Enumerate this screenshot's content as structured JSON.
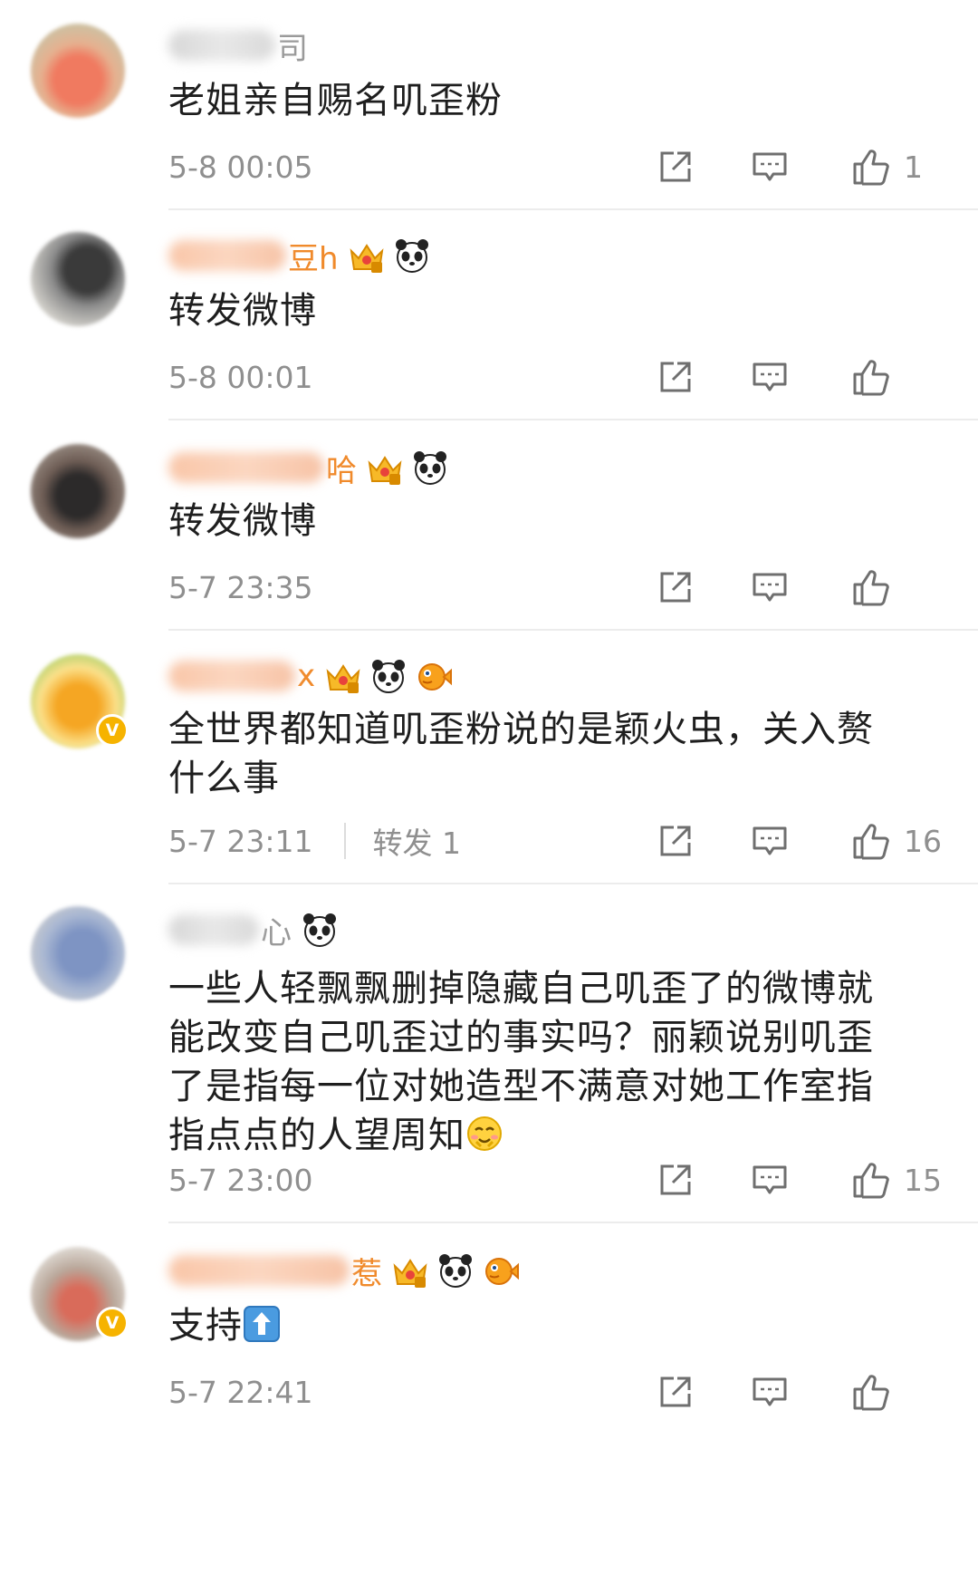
{
  "comments": [
    {
      "name_visible": "司",
      "text": "老姐亲自赐名叽歪粉",
      "time": "5-8 00:05",
      "repost": "",
      "likes": "1",
      "badges": []
    },
    {
      "name_visible": "豆h",
      "text": "转发微博",
      "time": "5-8 00:01",
      "repost": "",
      "likes": "",
      "badges": [
        "crown-badge-icon",
        "panda-badge-icon"
      ]
    },
    {
      "name_visible": "哈",
      "text": "转发微博",
      "time": "5-7 23:35",
      "repost": "",
      "likes": "",
      "badges": [
        "crown-badge-icon",
        "panda-badge-icon"
      ]
    },
    {
      "name_visible": "x",
      "text_line1": "全世界都知道叽歪粉说的是颖火虫，关入赘",
      "text_line2": "什么事",
      "time": "5-7 23:11",
      "repost": "转发 1",
      "likes": "16",
      "badges": [
        "crown-badge-icon",
        "panda-badge-icon",
        "pufferfish-badge-icon"
      ]
    },
    {
      "name_visible": "心",
      "text_line1": "一些人轻飘飘删掉隐藏自己叽歪了的微博就",
      "text_line2": "能改变自己叽歪过的事实吗？丽颖说别叽歪",
      "text_line3": "了是指每一位对她造型不满意对她工作室指",
      "text_line4": "指点点的人望周知",
      "time": "5-7 23:00",
      "repost": "",
      "likes": "15",
      "badges": [
        "panda-badge-icon"
      ]
    },
    {
      "name_visible": "惹",
      "text": "支持",
      "time": "5-7 22:41",
      "repost": "",
      "likes": "",
      "badges": [
        "crown-badge-icon",
        "panda-badge-icon",
        "pufferfish-badge-icon"
      ]
    }
  ],
  "icons": {
    "repost": "share-icon",
    "comment": "comment-icon",
    "like": "thumbs-up-icon",
    "verified": "verified-v-icon"
  },
  "colors": {
    "username": "#f08a2b",
    "meta": "#8f8f8f",
    "verified": "#f6b300"
  }
}
